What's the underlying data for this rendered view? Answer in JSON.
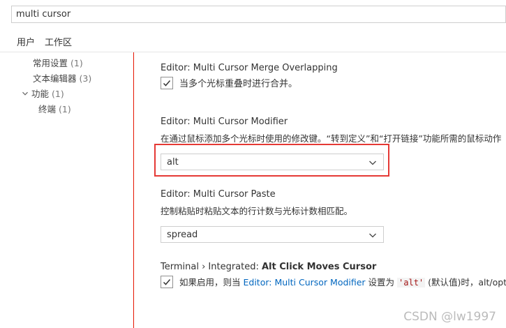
{
  "search": {
    "value": "multi cursor"
  },
  "scope_tabs": [
    "用户",
    "工作区"
  ],
  "toc": [
    {
      "label": "常用设置",
      "count": "(1)"
    },
    {
      "label": "文本编辑器",
      "count": "(3)"
    },
    {
      "label": "功能",
      "count": "(1)"
    },
    {
      "label": "终端",
      "count": "(1)"
    }
  ],
  "settings": {
    "merge": {
      "title": "Editor: Multi Cursor Merge Overlapping",
      "checkbox_label": "当多个光标重叠时进行合并。",
      "checked": true
    },
    "modifier": {
      "title": "Editor: Multi Cursor Modifier",
      "description": "在通过鼠标添加多个光标时使用的修改键。“转到定义”和“打开链接”功能所需的鼠标动作",
      "value": "alt"
    },
    "paste": {
      "title": "Editor: Multi Cursor Paste",
      "description": "控制粘贴时粘贴文本的行计数与光标计数相匹配。",
      "value": "spread"
    },
    "terminal": {
      "title_prefix": "Terminal › Integrated: ",
      "title_name": "Alt Click Moves Cursor",
      "desc_before": "如果启用，则当 ",
      "desc_link": "Editor: Multi Cursor Modifier",
      "desc_mid": " 设置为 ",
      "desc_code": "'alt'",
      "desc_after": " (默认值)时，alt/option",
      "checked": true
    }
  },
  "watermark": "CSDN @lw1997",
  "colors": {
    "highlight": "#e53935",
    "sash": "#e51400",
    "link": "#0066bf"
  }
}
